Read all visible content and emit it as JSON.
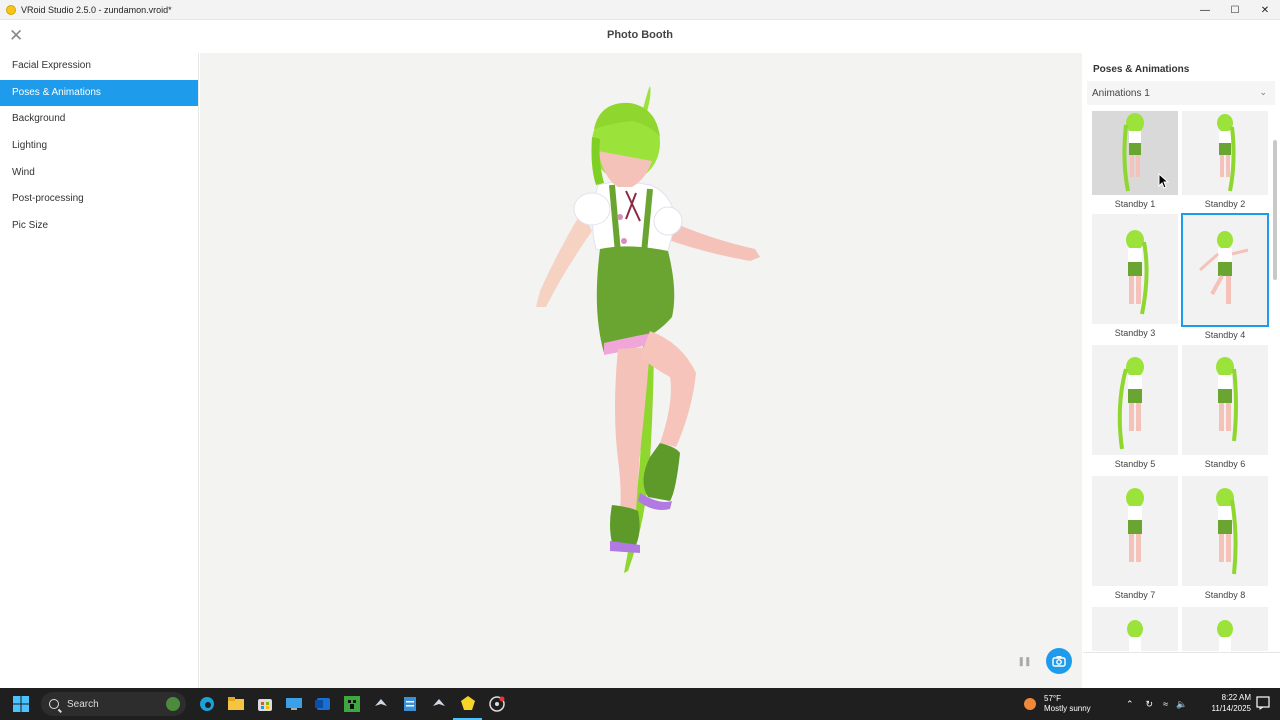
{
  "window": {
    "title": "VRoid Studio 2.5.0 - zundamon.vroid*",
    "controls": [
      "minimize",
      "maximize",
      "close"
    ]
  },
  "header": {
    "title": "Photo Booth"
  },
  "sidebar": {
    "items": [
      {
        "label": "Facial Expression",
        "active": false
      },
      {
        "label": "Poses & Animations",
        "active": true
      },
      {
        "label": "Background",
        "active": false
      },
      {
        "label": "Lighting",
        "active": false
      },
      {
        "label": "Wind",
        "active": false
      },
      {
        "label": "Post-processing",
        "active": false
      },
      {
        "label": "Pic Size",
        "active": false
      }
    ]
  },
  "panel": {
    "title": "Poses & Animations",
    "dropdown": {
      "selected": "Animations 1"
    },
    "animations": [
      {
        "label": "Standby 1",
        "state": "hover"
      },
      {
        "label": "Standby 2",
        "state": "normal"
      },
      {
        "label": "Standby 3",
        "state": "normal"
      },
      {
        "label": "Standby 4",
        "state": "selected"
      },
      {
        "label": "Standby 5",
        "state": "normal"
      },
      {
        "label": "Standby 6",
        "state": "normal"
      },
      {
        "label": "Standby 7",
        "state": "normal"
      },
      {
        "label": "Standby 8",
        "state": "normal"
      },
      {
        "label": "",
        "state": "normal"
      },
      {
        "label": "",
        "state": "normal"
      }
    ]
  },
  "viewport": {
    "controls": [
      "pause",
      "camera"
    ]
  },
  "taskbar": {
    "search_placeholder": "Search",
    "apps": [
      "file-explorer",
      "edge",
      "explorer-folder",
      "store",
      "remote",
      "outlook",
      "minecraft",
      "steam",
      "notepad",
      "steam-2",
      "vroid",
      "obs"
    ],
    "weather": {
      "temp": "57°F",
      "condition": "Mostly sunny"
    },
    "clock": {
      "time": "8:22 AM",
      "date": "11/14/2025"
    }
  },
  "colors": {
    "accent": "#1e9bea",
    "hair": "#9be33a",
    "shorts": "#6aa532",
    "skin": "#f4c2b8"
  }
}
